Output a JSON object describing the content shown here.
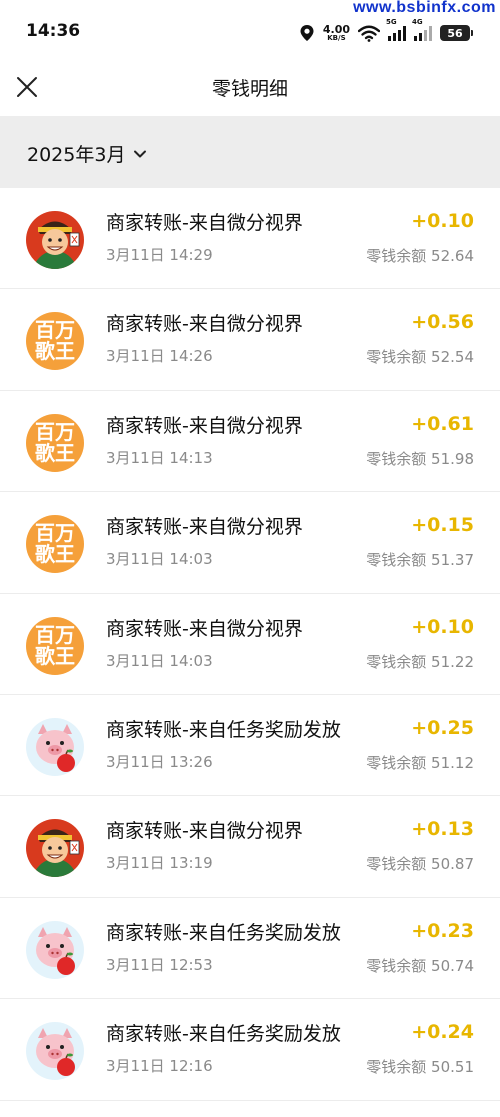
{
  "status": {
    "time": "14:36",
    "net_speed": "4.00",
    "net_unit": "KB/S",
    "sim1_label": "5G",
    "sim2_label": "4G",
    "battery": "56"
  },
  "watermark": "www.bsbinfx.com",
  "header": {
    "title": "零钱明细"
  },
  "filter": {
    "month": "2025年3月"
  },
  "transactions": [
    {
      "icon": "cartoon-hero-avatar-icon",
      "title": "商家转账-来自微分视界",
      "time": "3月11日 14:29",
      "amount": "+0.10",
      "balance": "零钱余额 52.64"
    },
    {
      "icon": "baiwan-gewang-logo-icon",
      "title": "商家转账-来自微分视界",
      "time": "3月11日 14:26",
      "amount": "+0.56",
      "balance": "零钱余额 52.54"
    },
    {
      "icon": "baiwan-gewang-logo-icon",
      "title": "商家转账-来自微分视界",
      "time": "3月11日 14:13",
      "amount": "+0.61",
      "balance": "零钱余额 51.98"
    },
    {
      "icon": "baiwan-gewang-logo-icon",
      "title": "商家转账-来自微分视界",
      "time": "3月11日 14:03",
      "amount": "+0.15",
      "balance": "零钱余额 51.37"
    },
    {
      "icon": "baiwan-gewang-logo-icon",
      "title": "商家转账-来自微分视界",
      "time": "3月11日 14:03",
      "amount": "+0.10",
      "balance": "零钱余额 51.22"
    },
    {
      "icon": "pig-with-apple-icon",
      "title": "商家转账-来自任务奖励发放",
      "time": "3月11日 13:26",
      "amount": "+0.25",
      "balance": "零钱余额 51.12"
    },
    {
      "icon": "cartoon-hero-avatar-icon",
      "title": "商家转账-来自微分视界",
      "time": "3月11日 13:19",
      "amount": "+0.13",
      "balance": "零钱余额 50.87"
    },
    {
      "icon": "pig-with-apple-icon",
      "title": "商家转账-来自任务奖励发放",
      "time": "3月11日 12:53",
      "amount": "+0.23",
      "balance": "零钱余额 50.74"
    },
    {
      "icon": "pig-with-apple-icon",
      "title": "商家转账-来自任务奖励发放",
      "time": "3月11日 12:16",
      "amount": "+0.24",
      "balance": "零钱余额 50.51"
    }
  ],
  "colors": {
    "amount": "#e8b600",
    "secondary_text": "#8a8a8a",
    "header_band": "#ededed",
    "logo_orange": "#f5a03a"
  },
  "logo_text": {
    "baiwan_top": "百万",
    "baiwan_bottom": "歌王"
  }
}
